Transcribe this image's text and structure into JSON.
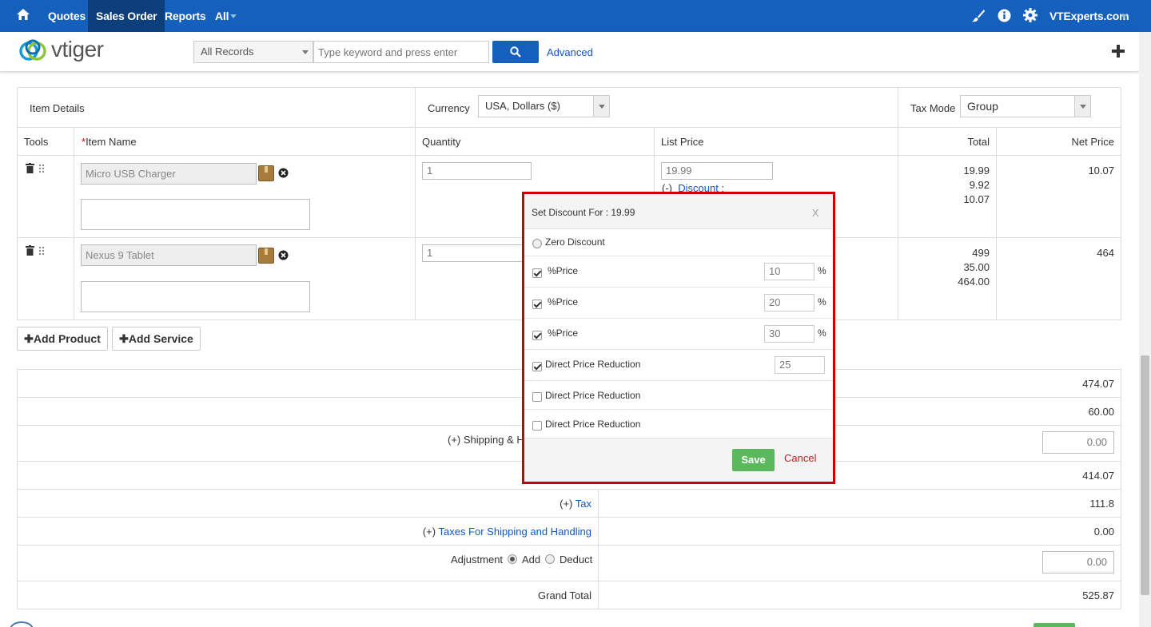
{
  "nav": {
    "items": [
      "Quotes",
      "Sales Order",
      "Reports",
      "All"
    ],
    "org": "VTExperts.com"
  },
  "search": {
    "filter": "All Records",
    "placeholder": "Type keyword and press enter",
    "advanced": "Advanced",
    "logo_text": "vtiger"
  },
  "items_header": {
    "title": "Item Details",
    "currency_label": "Currency",
    "currency_value": "USA, Dollars ($)",
    "tax_mode_label": "Tax Mode",
    "tax_mode_value": "Group"
  },
  "columns": [
    "Tools",
    "Item Name",
    "Quantity",
    "List Price",
    "Total",
    "Net Price"
  ],
  "items": [
    {
      "name": "Micro USB Charger",
      "qty": "1",
      "list_price": "19.99",
      "discount_label": "Discount",
      "discount_prefix": "(-)",
      "total": "19.99",
      "discount": "9.92",
      "after": "10.07",
      "net": "10.07"
    },
    {
      "name": "Nexus 9 Tablet",
      "qty": "1",
      "total": "499",
      "discount": "35.00",
      "after": "464.00",
      "net": "464"
    }
  ],
  "buttons": {
    "add_product": "Add Product",
    "add_service": "Add Service"
  },
  "summary": {
    "items_total": "474.07",
    "overall_discount": "60.00",
    "shipping_label": "Shipping & Ha",
    "shipping_prefix": "(+)",
    "shipping_value": "0.00",
    "pre_tax": "414.07",
    "tax_label": "Tax",
    "tax_prefix": "(+)",
    "tax_value": "111.8",
    "taxes_sh_label": "Taxes For Shipping and Handling",
    "taxes_sh_prefix": "(+)",
    "taxes_sh_value": "0.00",
    "adjustment_label": "Adjustment",
    "add_label": "Add",
    "deduct_label": "Deduct",
    "adjustment_value": "0.00",
    "grand_total_label": "Grand Total",
    "grand_total_value": "525.87"
  },
  "modal": {
    "title": "Set Discount For : 19.99",
    "close": "x",
    "zero_discount": "Zero Discount",
    "rows": [
      {
        "label": "%Price",
        "value": "10",
        "unit": "%",
        "checked": true
      },
      {
        "label": "%Price",
        "value": "20",
        "unit": "%",
        "checked": true
      },
      {
        "label": "%Price",
        "value": "30",
        "unit": "%",
        "checked": true
      },
      {
        "label": "Direct Price Reduction",
        "value": "25",
        "unit": "",
        "checked": true
      },
      {
        "label": "Direct Price Reduction",
        "value": "",
        "unit": "",
        "checked": false
      },
      {
        "label": "Direct Price Reduction",
        "value": "",
        "unit": "",
        "checked": false
      }
    ],
    "save": "Save",
    "cancel": "Cancel"
  },
  "colors": {
    "nav_bg": "#1560bd",
    "nav_active": "#0c3f7c",
    "modal_border": "#cc0000",
    "save_bg": "#5cb85c",
    "link": "#1155cc"
  }
}
